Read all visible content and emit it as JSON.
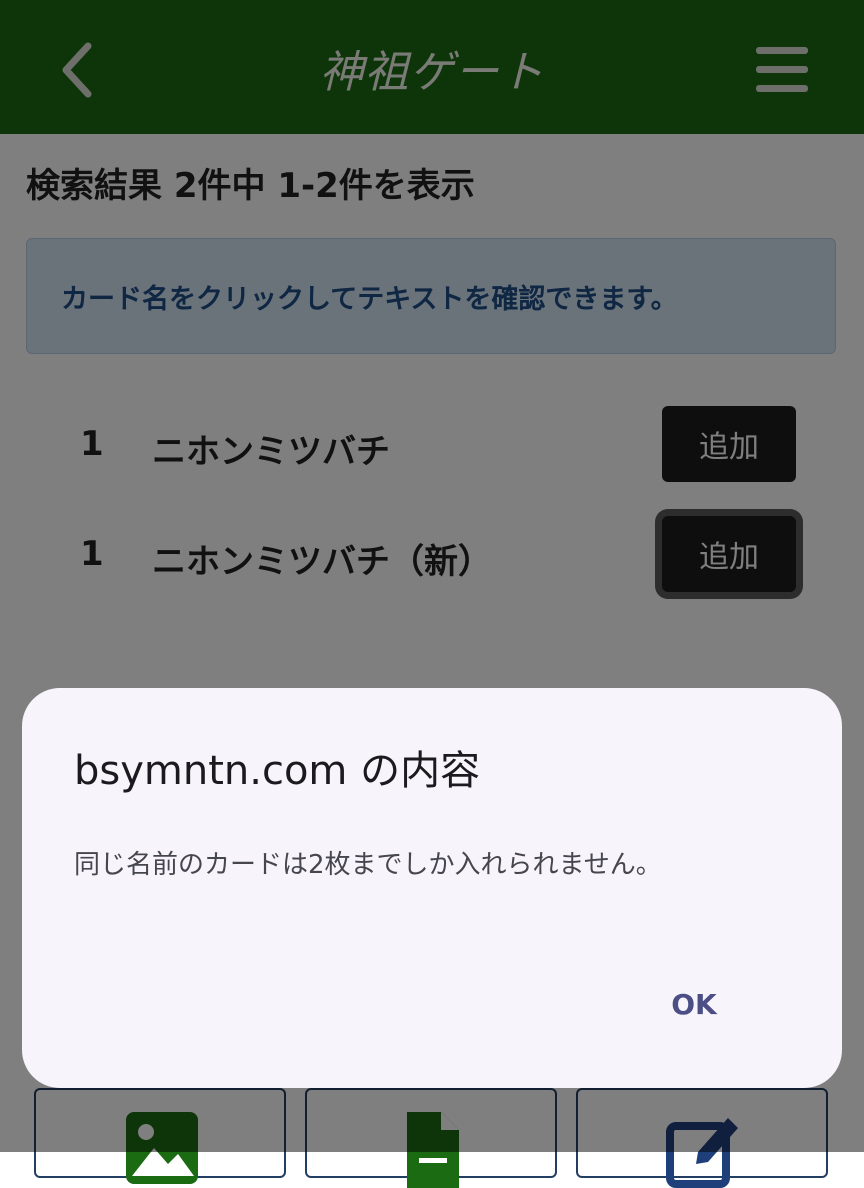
{
  "header": {
    "logo_text": "神祖ゲート",
    "back_icon": "chevron-left-icon",
    "menu_icon": "hamburger-menu-icon",
    "background": "#1a6b12"
  },
  "search": {
    "result_count": "検索結果 2件中 1-2件を表示",
    "info_message": "カード名をクリックしてテキストを確認できます。"
  },
  "cards": [
    {
      "count": "1",
      "name": "ニホンミツバチ",
      "button_label": "追加"
    },
    {
      "count": "1",
      "name": "ニホンミツバチ（新）",
      "button_label": "追加"
    }
  ],
  "bottom_toolbar": {
    "icons": [
      "image-icon",
      "file-icon",
      "edit-icon"
    ]
  },
  "dialog": {
    "title": "bsymntn.com の内容",
    "message": "同じ名前のカードは2枚までしか入れられません。",
    "ok_label": "OK"
  },
  "colors": {
    "accent": "#1a6b12",
    "info_bg": "#d4e4f5",
    "info_text": "#1f4f86",
    "button_bg": "#1c1c1c",
    "toolbar_icon": "#1a6b12",
    "toolbar_icon_edit": "#1f3f7a",
    "dialog_ok": "#4c4f86"
  }
}
